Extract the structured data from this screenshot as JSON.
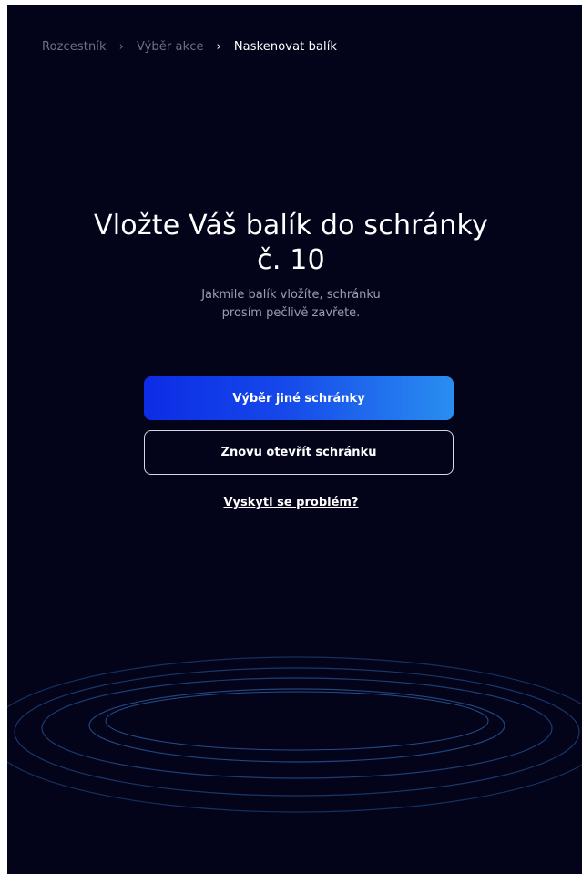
{
  "breadcrumb": {
    "items": [
      "Rozcestník",
      "Výběr akce",
      "Naskenovat balík"
    ],
    "separator": "›"
  },
  "main": {
    "title_line1": "Vložte Váš balík do schránky",
    "title_line2": "č. 10",
    "subtitle_line1": "Jakmile balík vložíte, schránku",
    "subtitle_line2": "prosím pečlivě zavřete."
  },
  "actions": {
    "primary_label": "Výběr jiné schránky",
    "secondary_label": "Znovu otevřít schránku",
    "problem_link": "Vyskytl se problém?"
  },
  "colors": {
    "background": "#03041a",
    "accent_start": "#0c2ce5",
    "accent_end": "#2a8ef0",
    "ring": "#1c3a6e"
  }
}
